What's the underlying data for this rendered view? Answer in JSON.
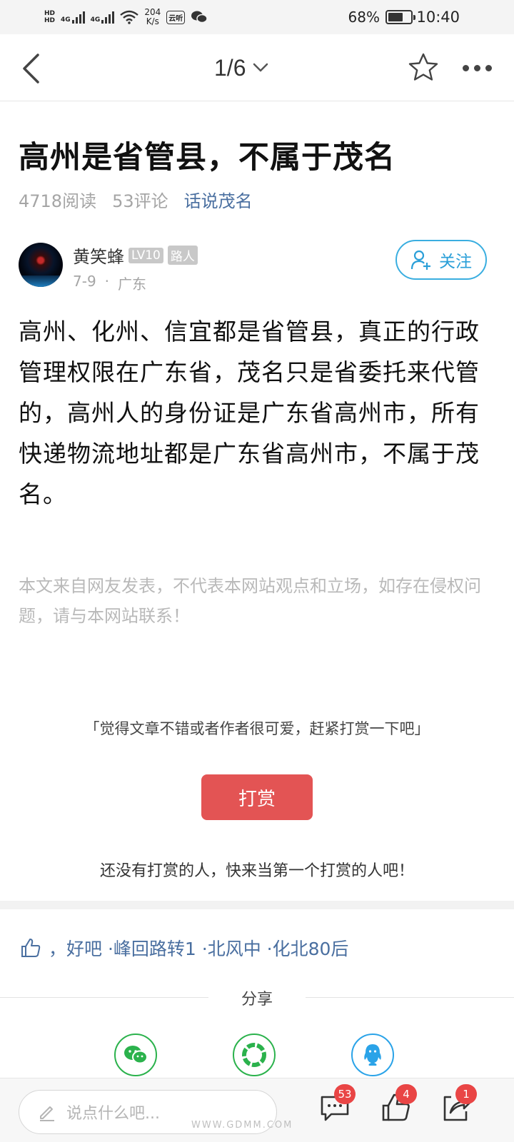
{
  "status_bar": {
    "hd_label": "HD",
    "network_1": "4G",
    "network_2": "4G",
    "speed_value": "204",
    "speed_unit": "K/s",
    "app_badge": "云听",
    "battery": "68%",
    "battery_level": 0.68,
    "time": "10:40"
  },
  "nav": {
    "page_indicator": "1/6",
    "back_icon": "chevron-left-icon",
    "dropdown_icon": "chevron-down-icon",
    "favorite_icon": "star-outline-icon",
    "more_icon": "more-dots-icon"
  },
  "article": {
    "title": "高州是省管县，不属于茂名",
    "reads": "4718阅读",
    "comments": "53评论",
    "topic": "话说茂名",
    "author": {
      "name": "黄笑蜂",
      "level": "LV10",
      "role": "路人",
      "date": "7-9",
      "separator": "·",
      "location": "广东",
      "follow_label": "关注"
    },
    "body": "高州、化州、信宜都是省管县，真正的行政管理权限在广东省，茂名只是省委托来代管的，高州人的身份证是广东省高州市，所有快递物流地址都是广东省高州市，不属于茂名。",
    "disclaimer": "本文来自网友发表，不代表本网站观点和立场，如存在侵权问题，请与本网站联系！"
  },
  "reward": {
    "hint": "「觉得文章不错或者作者很可爱，赶紧打赏一下吧」",
    "button_label": "打赏",
    "empty_text": "还没有打赏的人，快来当第一个打赏的人吧！",
    "button_color": "#e35454"
  },
  "likes": {
    "icon": "thumbs-up-icon",
    "text": "，好吧 ·峰回路转1 ·北风中 ·化北80后"
  },
  "share": {
    "title": "分享",
    "items": [
      {
        "name": "wechat",
        "icon": "wechat-icon",
        "color": "#2bb24c"
      },
      {
        "name": "moments",
        "icon": "moments-icon",
        "color": "#2bb24c"
      },
      {
        "name": "qq",
        "icon": "qq-icon",
        "color": "#2aa3e8"
      }
    ]
  },
  "bottom_bar": {
    "comment_placeholder": "说点什么吧...",
    "comment_count": "53",
    "like_count": "4",
    "share_count": "1"
  },
  "watermark": "WWW.GDMM.COM"
}
